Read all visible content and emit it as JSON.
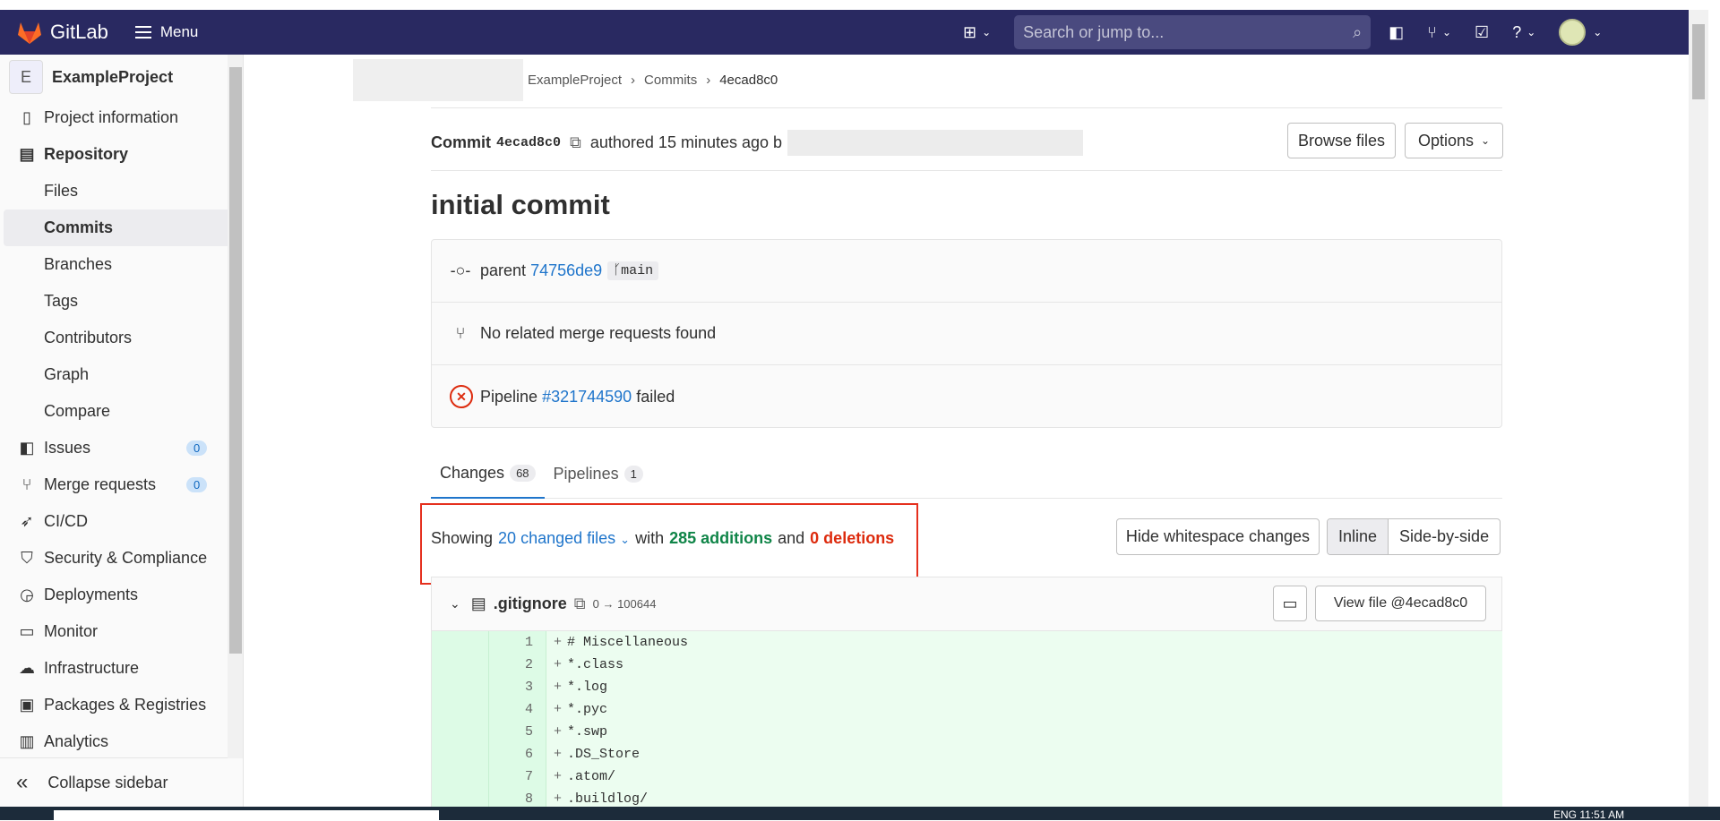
{
  "app": {
    "brand": "GitLab",
    "menu_label": "Menu",
    "search_placeholder": "Search or jump to..."
  },
  "sidebar": {
    "project_initial": "E",
    "project_name": "ExampleProject",
    "items": [
      {
        "label": "Project information",
        "icon": "info-book-icon"
      },
      {
        "label": "Repository",
        "icon": "document-icon"
      },
      {
        "label": "Files"
      },
      {
        "label": "Commits"
      },
      {
        "label": "Branches"
      },
      {
        "label": "Tags"
      },
      {
        "label": "Contributors"
      },
      {
        "label": "Graph"
      },
      {
        "label": "Compare"
      },
      {
        "label": "Issues",
        "badge": "0"
      },
      {
        "label": "Merge requests",
        "badge": "0"
      },
      {
        "label": "CI/CD"
      },
      {
        "label": "Security & Compliance"
      },
      {
        "label": "Deployments"
      },
      {
        "label": "Monitor"
      },
      {
        "label": "Infrastructure"
      },
      {
        "label": "Packages & Registries"
      },
      {
        "label": "Analytics"
      }
    ],
    "collapse_label": "Collapse sidebar"
  },
  "breadcrumb": {
    "project": "ExampleProject",
    "section": "Commits",
    "current": "4ecad8c0"
  },
  "commit": {
    "label": "Commit",
    "sha": "4ecad8c0",
    "authored": "authored 15 minutes ago b",
    "title": "initial commit",
    "browse_files": "Browse files",
    "options": "Options",
    "parent_label": "parent",
    "parent_sha": "74756de9",
    "branch": "main",
    "merge_requests": "No related merge requests found",
    "pipeline_label": "Pipeline",
    "pipeline_id": "#321744590",
    "pipeline_status": "failed"
  },
  "tabs": [
    {
      "label": "Changes",
      "count": "68"
    },
    {
      "label": "Pipelines",
      "count": "1"
    }
  ],
  "summary": {
    "showing": "Showing",
    "files": "20 changed files",
    "with": "with",
    "additions": "285 additions",
    "and": "and",
    "deletions": "0 deletions"
  },
  "controls": {
    "hide_whitespace": "Hide whitespace changes",
    "inline": "Inline",
    "side_by_side": "Side-by-side"
  },
  "file": {
    "name": ".gitignore",
    "mode": "0 → 100644",
    "view": "View file @4ecad8c0"
  },
  "diff_lines": [
    {
      "n": "1",
      "code": "# Miscellaneous"
    },
    {
      "n": "2",
      "code": "*.class"
    },
    {
      "n": "3",
      "code": "*.log"
    },
    {
      "n": "4",
      "code": "*.pyc"
    },
    {
      "n": "5",
      "code": "*.swp"
    },
    {
      "n": "6",
      "code": ".DS_Store"
    },
    {
      "n": "7",
      "code": ".atom/"
    },
    {
      "n": "8",
      "code": ".buildlog/"
    }
  ],
  "taskbar": {
    "clock": "ENG    11:51 AM"
  }
}
